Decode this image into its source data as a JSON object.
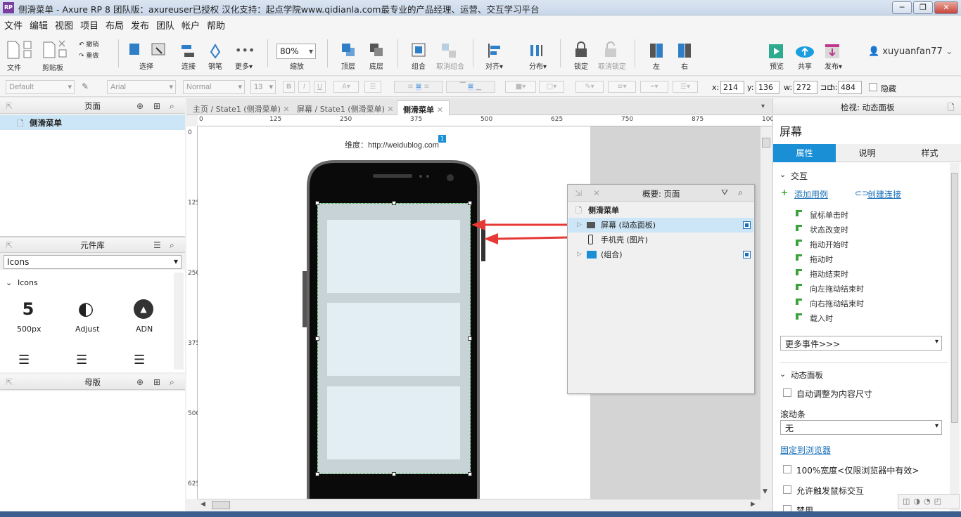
{
  "window": {
    "title": "侧滑菜单 - Axure RP 8 团队版：axureuser已授权 汉化支持：起点学院www.qidianla.com最专业的产品经理、运营、交互学习平台",
    "app_icon": "RP",
    "buttons": {
      "minimize": "─",
      "restore": "❐",
      "close": "✕"
    }
  },
  "menu": [
    "文件",
    "编辑",
    "视图",
    "项目",
    "布局",
    "发布",
    "团队",
    "帐户",
    "帮助"
  ],
  "toolbar": {
    "file": "文件",
    "clipboard": "剪贴板",
    "undo": "撤销",
    "redo": "重做",
    "select": "选择",
    "connect": "连接",
    "pen": "钢笔",
    "more": "更多▾",
    "zoom_value": "80%",
    "zoom_label": "缩放",
    "top": "顶层",
    "bottom": "底层",
    "group": "组合",
    "ungroup": "取消组合",
    "align": "对齐▾",
    "distribute": "分布▾",
    "lock": "锁定",
    "unlock": "取消锁定",
    "left": "左",
    "right": "右",
    "preview": "预览",
    "share": "共享",
    "publish": "发布▾",
    "user": "xuyuanfan77"
  },
  "format": {
    "style": "Default",
    "font": "Arial",
    "weight": "Normal",
    "size": "13",
    "x_label": "x:",
    "x": "214",
    "y_label": "y:",
    "y": "136",
    "w_label": "w:",
    "w": "272",
    "h_label": "h:",
    "h": "484",
    "hidden": "隐藏",
    "bold": "B",
    "italic": "I",
    "underline": "U"
  },
  "pages": {
    "title": "页面",
    "items": [
      "侧滑菜单"
    ]
  },
  "library": {
    "title": "元件库",
    "selected": "Icons",
    "group": "Icons",
    "icons": [
      {
        "name": "500px",
        "glyph": "5"
      },
      {
        "name": "Adjust",
        "glyph": "◐"
      },
      {
        "name": "ADN",
        "glyph": "▲"
      }
    ]
  },
  "masters": {
    "title": "母版"
  },
  "tabs": [
    {
      "label": "主页 / State1 (侧滑菜单)"
    },
    {
      "label": "屏幕 / State1 (侧滑菜单)"
    },
    {
      "label": "侧滑菜单",
      "active": true
    }
  ],
  "ruler": {
    "h": [
      "0",
      "125",
      "250",
      "375",
      "500",
      "625",
      "750",
      "875",
      "100"
    ],
    "v": [
      "0",
      "125",
      "250",
      "375",
      "500",
      "625"
    ]
  },
  "canvas": {
    "caption": "维度：http://weidublog.com",
    "badge": "1"
  },
  "overview": {
    "title": "概要: 页面",
    "page": "侧滑菜单",
    "items": [
      "屏幕 (动态面板)",
      "手机壳 (图片)",
      "(组合)"
    ]
  },
  "inspector": {
    "title": "检视: 动态面板",
    "name": "屏幕",
    "tabs": [
      "属性",
      "说明",
      "样式"
    ],
    "section_interaction": "交互",
    "add_case": "添加用例",
    "create_link": "创建连接",
    "events": [
      "鼠标单击时",
      "状态改变时",
      "拖动开始时",
      "拖动时",
      "拖动结束时",
      "向左拖动结束时",
      "向右拖动结束时",
      "载入时"
    ],
    "more_events": "更多事件>>>",
    "section_panel": "动态面板",
    "auto_fit": "自动调整为内容尺寸",
    "scrollbar_label": "滚动条",
    "scrollbar_value": "无",
    "pin": "固定到浏览器",
    "full_width": "100%宽度<仅限浏览器中有效>",
    "allow_touch": "允许触发鼠标交互",
    "disable": "禁用"
  },
  "colors": {
    "accent": "#1a8fd6",
    "selection": "#cde6f7",
    "arrow": "#e53935",
    "panel_fill": "#c8d3d8",
    "panel_slot": "#e3eef4",
    "app_purple": "#7b3fa0"
  }
}
